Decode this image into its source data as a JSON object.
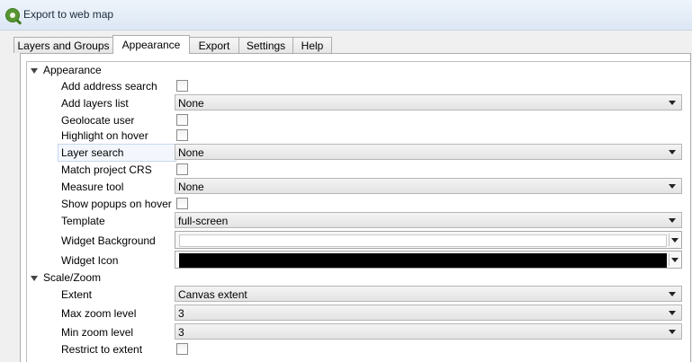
{
  "window": {
    "title": "Export to web map"
  },
  "tabs": [
    {
      "label": "Layers and Groups"
    },
    {
      "label": "Appearance"
    },
    {
      "label": "Export"
    },
    {
      "label": "Settings"
    },
    {
      "label": "Help"
    }
  ],
  "active_tab": "Appearance",
  "sections": {
    "appearance": {
      "label": "Appearance"
    },
    "scale_zoom": {
      "label": "Scale/Zoom"
    }
  },
  "appearance_rows": {
    "add_address_search": {
      "label": "Add address search",
      "checked": false
    },
    "add_layers_list": {
      "label": "Add layers list",
      "value": "None"
    },
    "geolocate_user": {
      "label": "Geolocate user",
      "checked": false
    },
    "highlight_on_hover": {
      "label": "Highlight on hover",
      "checked": false
    },
    "layer_search": {
      "label": "Layer search",
      "value": "None"
    },
    "match_project_crs": {
      "label": "Match project CRS",
      "checked": false
    },
    "measure_tool": {
      "label": "Measure tool",
      "value": "None"
    },
    "show_popups_on_hover": {
      "label": "Show popups on hover",
      "checked": false
    },
    "template": {
      "label": "Template",
      "value": "full-screen"
    },
    "widget_background": {
      "label": "Widget Background",
      "color": "#ffffff"
    },
    "widget_icon": {
      "label": "Widget Icon",
      "color": "#000000"
    }
  },
  "scale_rows": {
    "extent": {
      "label": "Extent",
      "value": "Canvas extent"
    },
    "max_zoom": {
      "label": "Max zoom level",
      "value": "3"
    },
    "min_zoom": {
      "label": "Min zoom level",
      "value": "3"
    },
    "restrict_to_extent": {
      "label": "Restrict to extent",
      "checked": false
    }
  }
}
